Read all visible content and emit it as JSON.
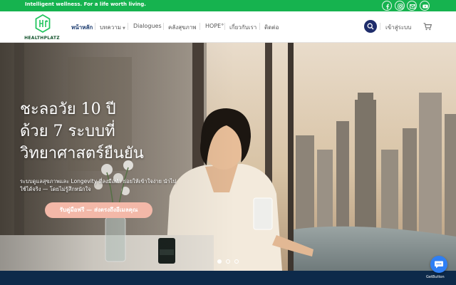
{
  "topbar": {
    "tagline": "Intelligent wellness. For a life worth living.",
    "social_icons": [
      "facebook-icon",
      "instagram-icon",
      "email-icon",
      "youtube-icon"
    ]
  },
  "header": {
    "logo_text": "HEALTHPLATZ",
    "nav": [
      {
        "label": "หน้าหลัก",
        "active": true
      },
      {
        "label": "บทความ",
        "has_dropdown": true
      },
      {
        "label": "Dialogues"
      },
      {
        "label": "คลังสุขภาพ"
      },
      {
        "label": "HOPE°"
      },
      {
        "label": "เกี่ยวกับเรา"
      },
      {
        "label": "ติดต่อ"
      }
    ],
    "login_label": "เข้าสู่ระบบ"
  },
  "hero": {
    "title_line1": "ชะลอวัย 10 ปี",
    "title_line2": "ด้วย 7 ระบบที่",
    "title_line3": "วิทยาศาสตร์ยืนยัน",
    "subtitle": "ระบบดูแลสุขภาพและ Longevity ที่ลงมือทำ ย่อยให้เข้าใจง่าย นำไปใช้ได้จริง — โดยไม่รู้สึกหนักใจ",
    "cta_label": "รับคู่มือฟรี — ส่งตรงถึงอีเมลคุณ",
    "slides": 3,
    "active_slide": 1
  },
  "widget": {
    "getbutton_label": "GetButton"
  },
  "colors": {
    "topbar": "#16b34f",
    "nav_active": "#1a3a6e",
    "search": "#1f2d6b",
    "cta": "#f3b8a8",
    "footer_band": "#0d2a4a",
    "chat": "#2f7ff4"
  }
}
